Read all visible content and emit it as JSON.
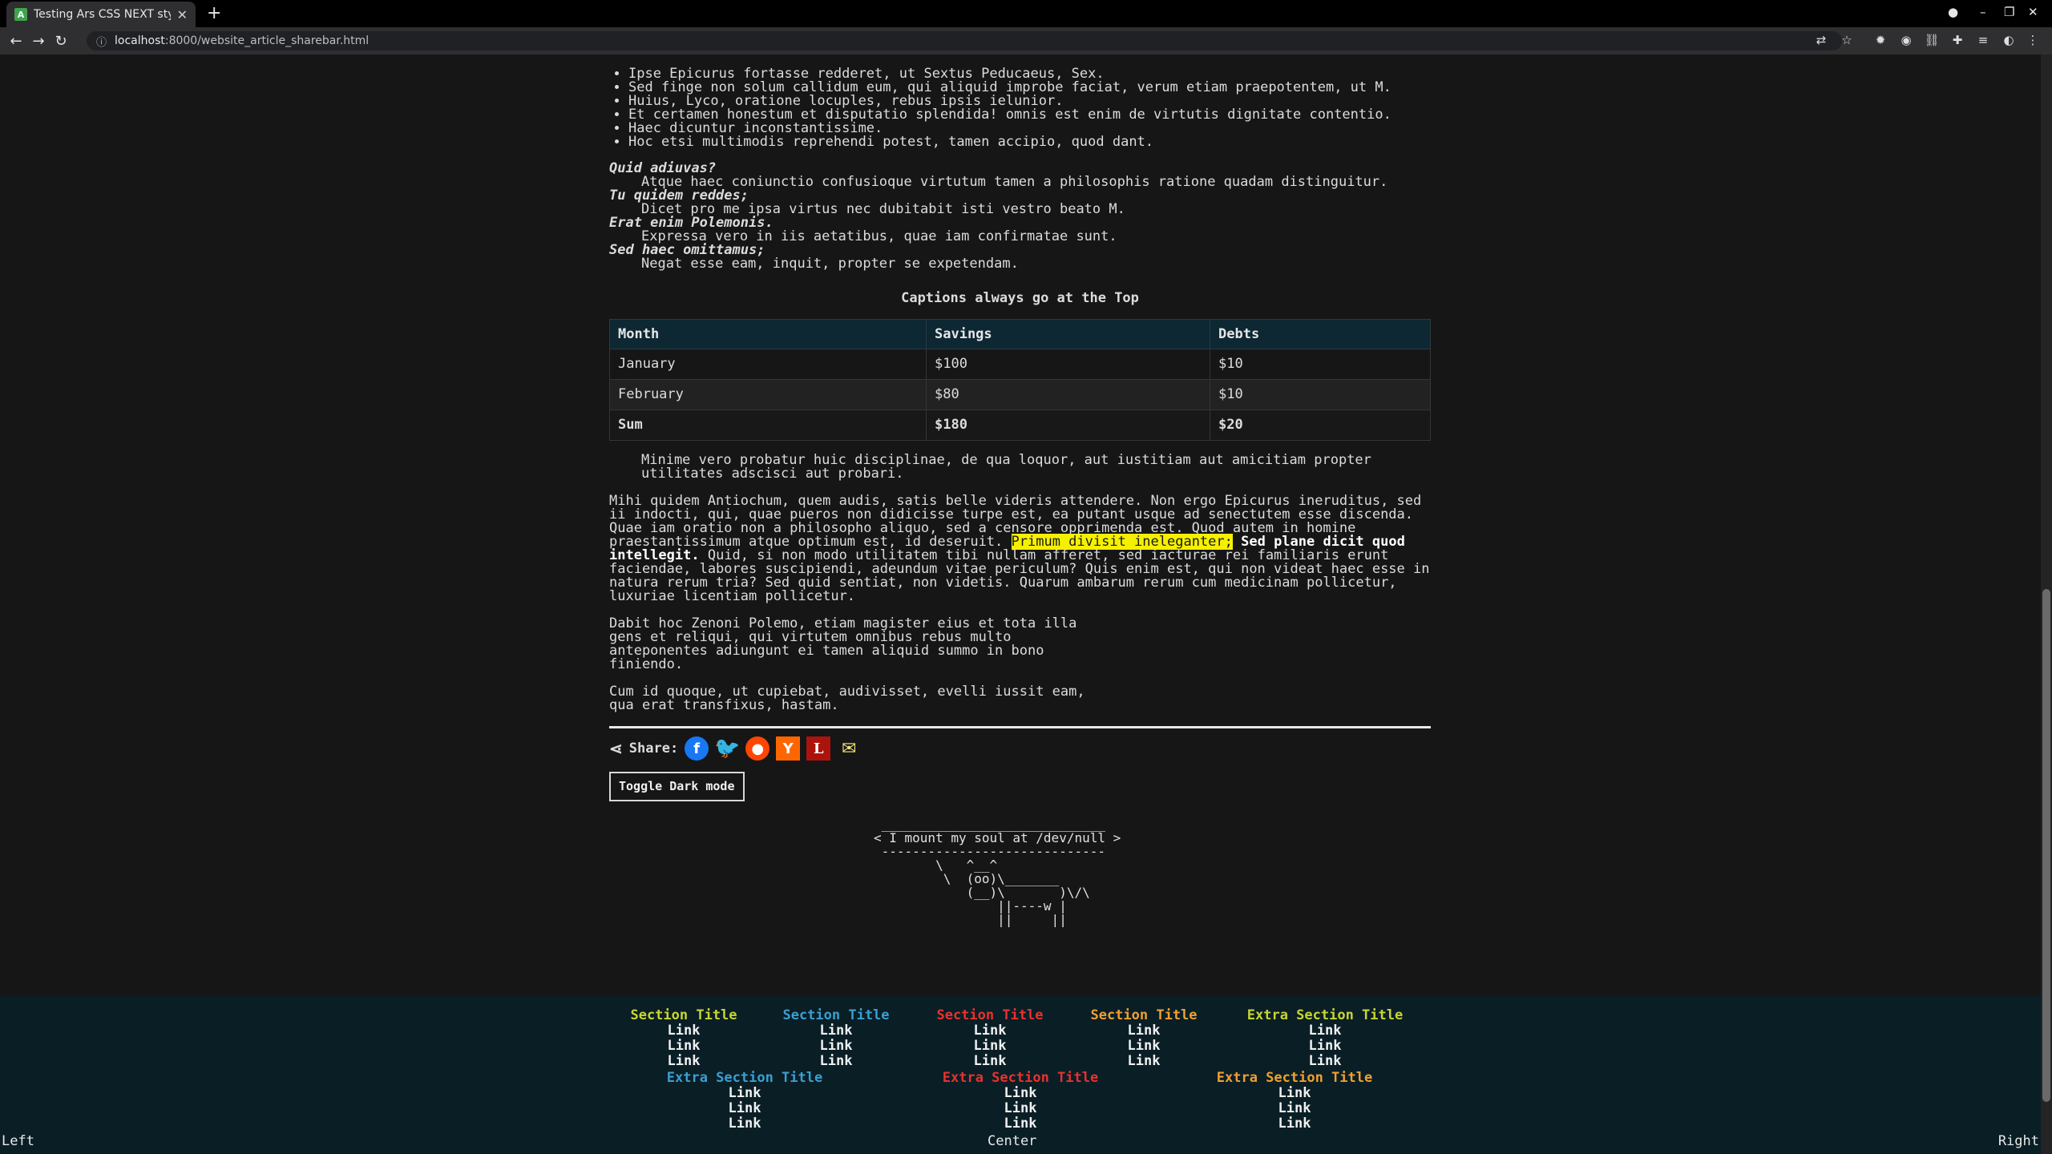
{
  "browser": {
    "tab_title": "Testing Ars CSS NEXT styling",
    "tab_favicon": "A",
    "url_host": "localhost",
    "url_path": ":8000/website_article_sharebar.html"
  },
  "content": {
    "bullets": [
      "Ipse Epicurus fortasse redderet, ut Sextus Peducaeus, Sex.",
      "Sed finge non solum callidum eum, qui aliquid improbe faciat, verum etiam praepotentem, ut M.",
      "Huius, Lyco, oratione locuples, rebus ipsis ielunior.",
      "Et certamen honestum et disputatio splendida! omnis est enim de virtutis dignitate contentio.",
      "Haec dicuntur inconstantissime.",
      "Hoc etsi multimodis reprehendi potest, tamen accipio, quod dant."
    ],
    "definitions": [
      {
        "term": "Quid adiuvas?",
        "desc": "Atque haec coniunctio confusioque virtutum tamen a philosophis ratione quadam distinguitur."
      },
      {
        "term": "Tu quidem reddes;",
        "desc": "Dicet pro me ipsa virtus nec dubitabit isti vestro beato M."
      },
      {
        "term": "Erat enim Polemonis.",
        "desc": "Expressa vero in iis aetatibus, quae iam confirmatae sunt."
      },
      {
        "term": "Sed haec omittamus;",
        "desc": "Negat esse eam, inquit, propter se expetendam."
      }
    ],
    "table": {
      "caption": "Captions always go at the Top",
      "headers": [
        "Month",
        "Savings",
        "Debts"
      ],
      "rows": [
        [
          "January",
          "$100",
          "$10"
        ],
        [
          "February",
          "$80",
          "$10"
        ]
      ],
      "sum": [
        "Sum",
        "$180",
        "$20"
      ]
    },
    "blockquote": "Minime vero probatur huic disciplinae, de qua loquor, aut iustitiam aut amicitiam propter utilitates adscisci aut probari.",
    "para1": "Mihi quidem Antiochum, quem audis, satis belle videris attendere. Non ergo Epicurus ineruditus, sed ii indocti, qui, quae pueros non didicisse turpe est, ea putant usque ad senectutem esse discenda. Quae iam oratio non a philosopho aliquo, sed a censore opprimenda est. Quod autem in homine praestantissimum atque optimum est, id deseruit.",
    "para1_mark": "Primum divisit ineleganter;",
    "para1_strong": "Sed plane dicit quod intellegit.",
    "para1_tail": "Quid, si non modo utilitatem tibi nullam afferet, sed iacturae rei familiaris erunt faciendae, labores suscipiendi, adeundum vitae periculum? Quis enim est, qui non videat haec esse in natura rerum tria? Sed quid sentiat, non videtis. Quarum ambarum rerum cum medicinam pollicetur, luxuriae licentiam pollicetur.",
    "para2": "Dabit hoc Zenoni Polemo, etiam magister eius et tota illa\ngens et reliqui, qui virtutem omnibus rebus multo\nanteponentes adiungunt ei tamen aliquid summo in bono\nfiniendo.",
    "para3": "Cum id quoque, ut cupiebat, audivisset, evelli iussit eam,\nqua erat transfixus, hastam.",
    "share_label": "Share:",
    "share_icons": [
      "facebook-icon",
      "twitter-icon",
      "reddit-icon",
      "hacker-news-icon",
      "lobsters-icon",
      "mail-icon"
    ],
    "toggle_label": "Toggle Dark mode",
    "cowsay": " _____________________________\n< I mount my soul at /dev/null >\n -----------------------------\n        \\   ^__^\n         \\  (oo)\\_______\n            (__)\\       )\\/\\\n                ||----w |\n                ||     ||"
  },
  "footer": {
    "sections": [
      {
        "title": "Section Title",
        "color": "#c8d630",
        "links": [
          "Link",
          "Link",
          "Link"
        ]
      },
      {
        "title": "Section Title",
        "color": "#3aa0d0",
        "links": [
          "Link",
          "Link",
          "Link"
        ]
      },
      {
        "title": "Section Title",
        "color": "#e8322e",
        "links": [
          "Link",
          "Link",
          "Link"
        ]
      },
      {
        "title": "Section Title",
        "color": "#f0a030",
        "links": [
          "Link",
          "Link",
          "Link"
        ]
      },
      {
        "title": "Extra Section Title",
        "color": "#c8d630",
        "links": [
          "Link",
          "Link",
          "Link"
        ]
      },
      {
        "title": "Extra Section Title",
        "color": "#3aa0d0",
        "links": [
          "Link",
          "Link",
          "Link"
        ]
      },
      {
        "title": "Extra Section Title",
        "color": "#e8322e",
        "links": [
          "Link",
          "Link",
          "Link"
        ]
      },
      {
        "title": "Extra Section Title",
        "color": "#f0a030",
        "links": [
          "Link",
          "Link",
          "Link"
        ]
      }
    ],
    "left": "Left",
    "center": "Center",
    "right": "Right"
  }
}
